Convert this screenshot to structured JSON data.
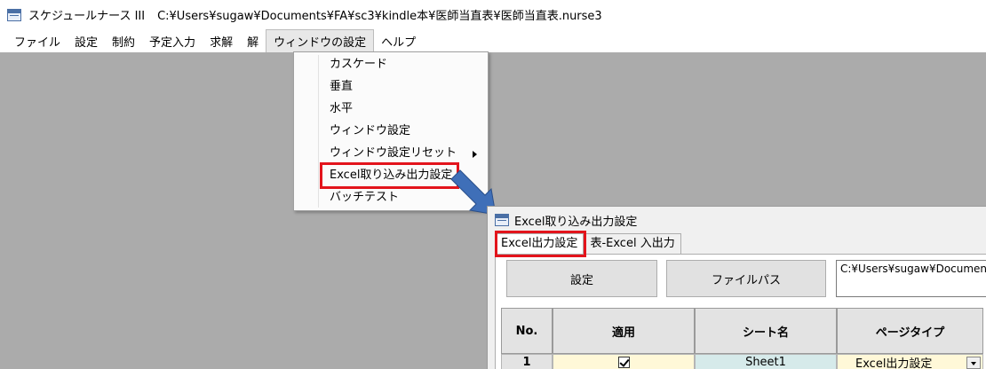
{
  "window": {
    "app_title": "スケジュールナース III",
    "file_path": "C:¥Users¥sugaw¥Documents¥FA¥sc3¥kindle本¥医師当直表¥医師当直表.nurse3"
  },
  "menubar": {
    "items": [
      "ファイル",
      "設定",
      "制約",
      "予定入力",
      "求解",
      "解",
      "ウィンドウの設定",
      "ヘルプ"
    ]
  },
  "window_menu": {
    "items": [
      "カスケード",
      "垂直",
      "水平",
      "ウィンドウ設定",
      "ウィンドウ設定リセット",
      "Excel取り込み出力設定",
      "バッチテスト"
    ]
  },
  "excel_dialog": {
    "title": "Excel取り込み出力設定",
    "tabs": [
      "Excel出力設定",
      "表-Excel 入出力"
    ],
    "settings_button": "設定",
    "filepath_button": "ファイルパス",
    "path_value": "C:¥Users¥sugaw¥Documents",
    "columns": [
      "No.",
      "適用",
      "シート名",
      "ページタイプ"
    ],
    "rows": [
      {
        "no": "1",
        "applied": true,
        "sheet": "Sheet1",
        "page_type": "Excel出力設定"
      }
    ]
  },
  "colors": {
    "highlight": "#e3141c",
    "arrow": "#3f6fb8",
    "background": "#ababab",
    "row_applied_bg": "#fff8d8",
    "row_sheet_bg": "#d6eaea"
  },
  "icons": {
    "app": "app-window-icon",
    "pointer": "blue-arrow-icon",
    "submenu": "submenu-arrow-icon"
  }
}
